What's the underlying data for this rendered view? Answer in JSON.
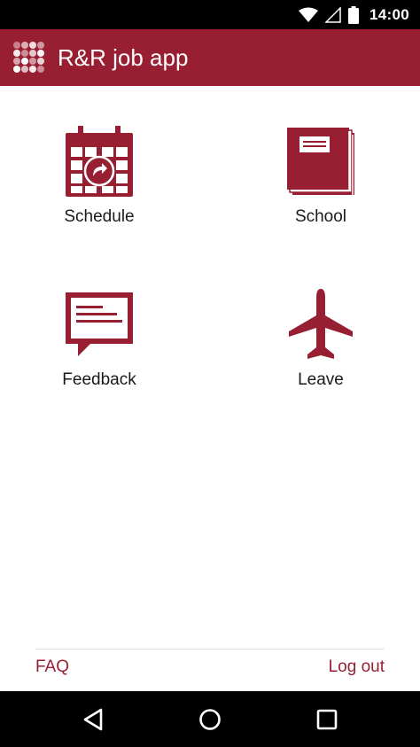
{
  "status_bar": {
    "time": "14:00",
    "icons": [
      "wifi-icon",
      "cell-signal-icon",
      "battery-icon"
    ]
  },
  "app_bar": {
    "title": "R&R job app",
    "logo": "dot-grid-logo",
    "background": "#981e32"
  },
  "tiles": [
    {
      "label": "Schedule",
      "icon": "calendar-icon"
    },
    {
      "label": "School",
      "icon": "book-icon"
    },
    {
      "label": "Feedback",
      "icon": "feedback-icon"
    },
    {
      "label": "Leave",
      "icon": "airplane-icon"
    }
  ],
  "footer": {
    "faq_label": "FAQ",
    "logout_label": "Log out"
  },
  "nav_bar": {
    "icons": [
      "back-icon",
      "home-icon",
      "recents-icon"
    ]
  },
  "colors": {
    "accent": "#981e32",
    "text": "#1a1a1a"
  }
}
